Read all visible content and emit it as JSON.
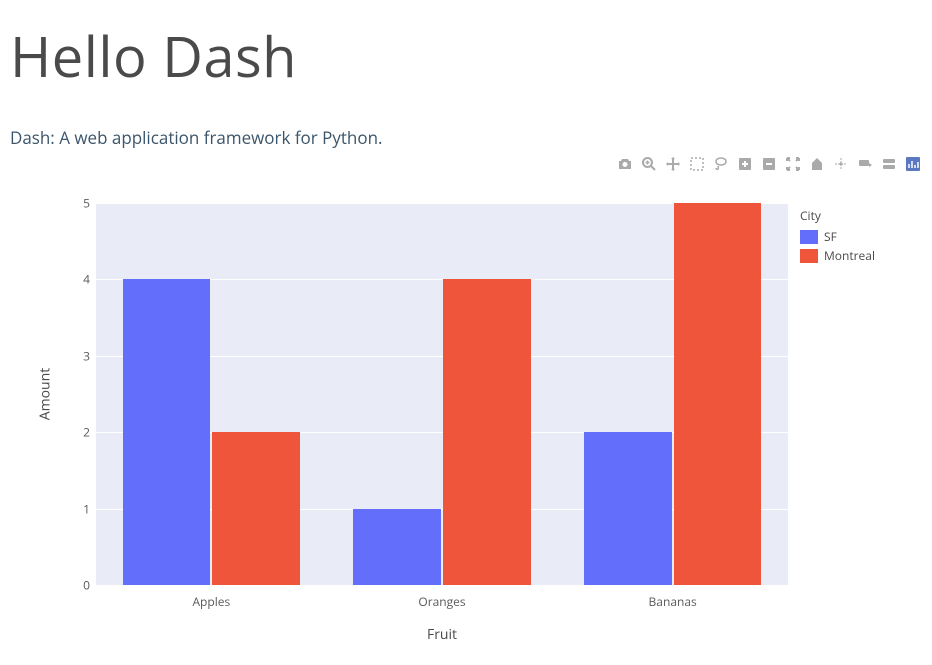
{
  "header": {
    "title": "Hello Dash",
    "subtitle": "Dash: A web application framework for Python."
  },
  "toolbar": {
    "icons": [
      "camera-icon",
      "zoom-icon",
      "pan-icon",
      "select-box-icon",
      "lasso-icon",
      "zoom-in-icon",
      "zoom-out-icon",
      "autoscale-icon",
      "reset-axes-icon",
      "spike-lines-icon",
      "hover-closest-icon",
      "hover-compare-icon",
      "plotly-logo-icon"
    ]
  },
  "chart_data": {
    "type": "bar",
    "categories": [
      "Apples",
      "Oranges",
      "Bananas"
    ],
    "series": [
      {
        "name": "SF",
        "values": [
          4,
          1,
          2
        ],
        "color": "#636efa"
      },
      {
        "name": "Montreal",
        "values": [
          2,
          4,
          5
        ],
        "color": "#ef553b"
      }
    ],
    "xlabel": "Fruit",
    "ylabel": "Amount",
    "ylim": [
      0,
      5
    ],
    "y_ticks": [
      0,
      1,
      2,
      3,
      4,
      5
    ],
    "legend_title": "City"
  }
}
